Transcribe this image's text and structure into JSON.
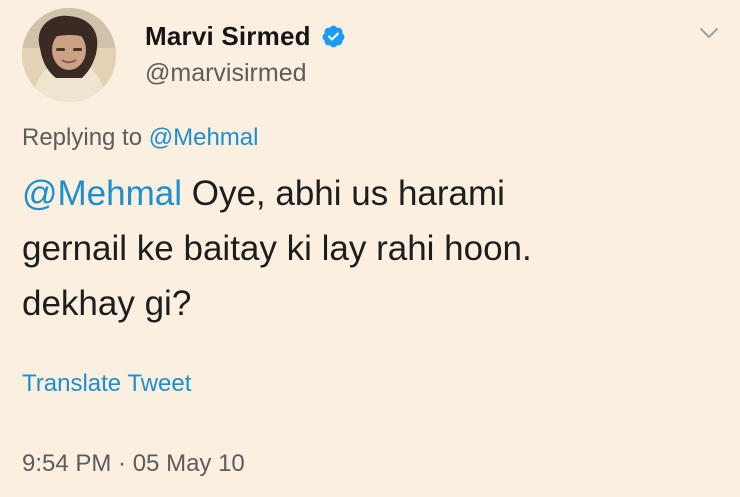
{
  "author": {
    "display_name": "Marvi Sirmed",
    "handle": "@marvisirmed",
    "verified": true
  },
  "reply": {
    "prefix": "Replying to ",
    "mention": "@Mehmal"
  },
  "tweet": {
    "mention": "@Mehmal",
    "line1_rest": " Oye, abhi us harami",
    "line2": "gernail ke baitay ki lay rahi hoon.",
    "line3": "dekhay gi?"
  },
  "actions": {
    "translate_label": "Translate Tweet"
  },
  "meta": {
    "timestamp": "9:54 PM · 05 May 10"
  },
  "icons": {
    "verified": "verified-badge-icon",
    "menu": "chevron-down-icon"
  },
  "colors": {
    "background": "#fbefe0",
    "link": "#1c8fd1",
    "verified": "#1d9bf0",
    "muted_text": "#5c5c5c"
  }
}
